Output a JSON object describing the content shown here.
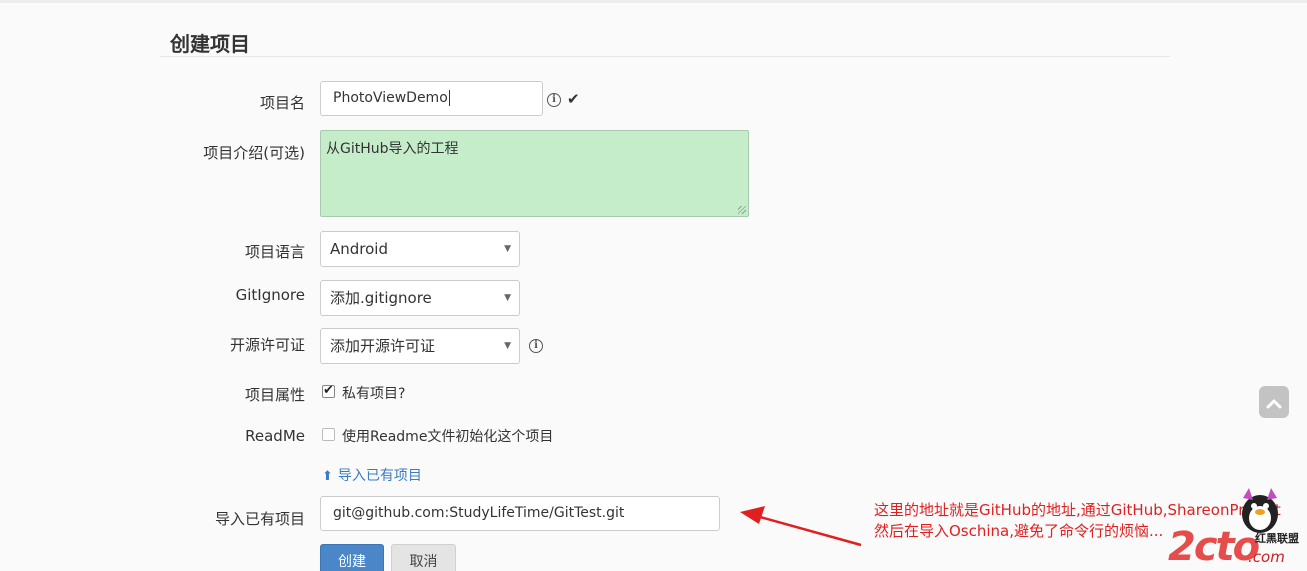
{
  "page_title": "创建项目",
  "form": {
    "name": {
      "label": "项目名",
      "value": "PhotoViewDemo"
    },
    "description": {
      "label": "项目介绍(可选)",
      "value": "从GitHub导入的工程"
    },
    "language": {
      "label": "项目语言",
      "selected": "Android"
    },
    "gitignore": {
      "label": "GitIgnore",
      "selected": "添加.gitignore"
    },
    "license": {
      "label": "开源许可证",
      "selected": "添加开源许可证"
    },
    "attributes": {
      "label": "项目属性",
      "private_label": "私有项目?",
      "private_checked": true
    },
    "readme": {
      "label": "ReadMe",
      "init_label": "使用Readme文件初始化这个项目",
      "init_checked": false
    },
    "import_link": "导入已有项目",
    "import_url": {
      "label": "导入已有项目",
      "value": "git@github.com:StudyLifeTime/GitTest.git"
    }
  },
  "buttons": {
    "create": "创建",
    "cancel": "取消"
  },
  "annotation": {
    "line1": "这里的地址就是GitHub的地址,通过GitHub,ShareonProject",
    "line2": "然后在导入Oschina,避免了命令行的烦恼..."
  },
  "watermark": {
    "brand": "2cto",
    "suffix": ".com",
    "union": "红黑联盟"
  },
  "colors": {
    "accent": "#4a86c8",
    "textarea_bg": "#c6edca",
    "annotation": "#e02020"
  },
  "icons": {
    "info": "info-circle-icon",
    "check": "checkmark-icon",
    "upload": "upload-icon",
    "scroll_top": "chevron-up-icon"
  }
}
